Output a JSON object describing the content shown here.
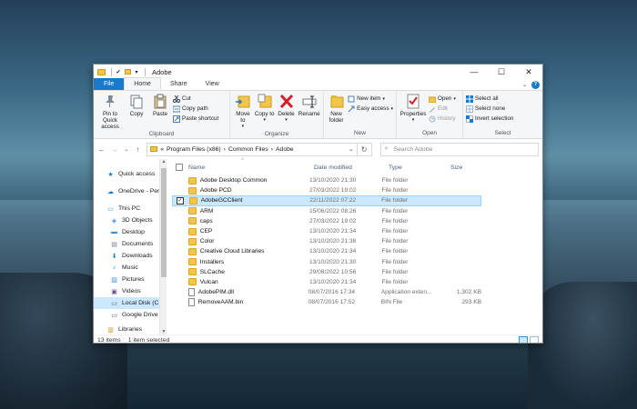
{
  "window": {
    "title": "Adobe",
    "controls": {
      "minimize": "—",
      "maximize": "☐",
      "close": "✕"
    }
  },
  "ribbon_tabs": [
    "File",
    "Home",
    "Share",
    "View"
  ],
  "ribbon": {
    "clipboard": {
      "pin": "Pin to Quick access",
      "copy": "Copy",
      "paste": "Paste",
      "cut": "Cut",
      "copy_path": "Copy path",
      "paste_shortcut": "Paste shortcut",
      "label": "Clipboard"
    },
    "organize": {
      "move_to": "Move to",
      "copy_to": "Copy to",
      "delete": "Delete",
      "rename": "Rename",
      "label": "Organize"
    },
    "new": {
      "new_folder": "New folder",
      "new_item": "New item",
      "easy_access": "Easy access",
      "label": "New"
    },
    "open": {
      "properties": "Properties",
      "open": "Open",
      "edit": "Edit",
      "history": "History",
      "label": "Open"
    },
    "select": {
      "select_all": "Select all",
      "select_none": "Select none",
      "invert_selection": "Invert selection",
      "label": "Select"
    }
  },
  "address": {
    "prefix": "«",
    "path": [
      "Program Files (x86)",
      "Common Files",
      "Adobe"
    ],
    "search_placeholder": "Search Adobe"
  },
  "nav_pane": [
    {
      "label": "Quick access",
      "icon": "star-icon"
    },
    {
      "label": "OneDrive - Persor",
      "icon": "cloud-icon"
    },
    {
      "label": "This PC",
      "icon": "computer-icon"
    },
    {
      "label": "3D Objects",
      "icon": "cube-icon"
    },
    {
      "label": "Desktop",
      "icon": "desktop-icon"
    },
    {
      "label": "Documents",
      "icon": "documents-icon"
    },
    {
      "label": "Downloads",
      "icon": "download-icon"
    },
    {
      "label": "Music",
      "icon": "music-icon"
    },
    {
      "label": "Pictures",
      "icon": "pictures-icon"
    },
    {
      "label": "Videos",
      "icon": "video-icon"
    },
    {
      "label": "Local Disk (C:)",
      "icon": "drive-icon"
    },
    {
      "label": "Google Drive (G:",
      "icon": "drive-icon"
    },
    {
      "label": "Libraries",
      "icon": "library-icon"
    }
  ],
  "columns": {
    "name": "Name",
    "date": "Date modified",
    "type": "Type",
    "size": "Size"
  },
  "files": [
    {
      "name": "Adobe Desktop Common",
      "date": "13/10/2020 21:30",
      "type": "File folder",
      "size": "",
      "kind": "folder"
    },
    {
      "name": "Adobe PCD",
      "date": "27/03/2022 19:02",
      "type": "File folder",
      "size": "",
      "kind": "folder"
    },
    {
      "name": "AdobeGCClient",
      "date": "22/11/2022 07:22",
      "type": "File folder",
      "size": "",
      "kind": "folder"
    },
    {
      "name": "ARM",
      "date": "15/06/2022 08:26",
      "type": "File folder",
      "size": "",
      "kind": "folder"
    },
    {
      "name": "caps",
      "date": "27/03/2022 19:02",
      "type": "File folder",
      "size": "",
      "kind": "folder"
    },
    {
      "name": "CEP",
      "date": "13/10/2020 21:34",
      "type": "File folder",
      "size": "",
      "kind": "folder"
    },
    {
      "name": "Color",
      "date": "13/10/2020 21:38",
      "type": "File folder",
      "size": "",
      "kind": "folder"
    },
    {
      "name": "Creative Cloud Libraries",
      "date": "13/10/2020 21:34",
      "type": "File folder",
      "size": "",
      "kind": "folder"
    },
    {
      "name": "Installers",
      "date": "13/10/2020 21:30",
      "type": "File folder",
      "size": "",
      "kind": "folder"
    },
    {
      "name": "SLCache",
      "date": "29/08/2022 10:56",
      "type": "File folder",
      "size": "",
      "kind": "folder"
    },
    {
      "name": "Vulcan",
      "date": "13/10/2020 21:34",
      "type": "File folder",
      "size": "",
      "kind": "folder"
    },
    {
      "name": "AdobePIM.dll",
      "date": "08/07/2016 17:34",
      "type": "Application exten...",
      "size": "1,302 KB",
      "kind": "file"
    },
    {
      "name": "RemoveAAM.bin",
      "date": "08/07/2016 17:52",
      "type": "BIN File",
      "size": "293 KB",
      "kind": "file"
    }
  ],
  "selected_row": 2,
  "status": {
    "items": "13 items",
    "selected": "1 item selected"
  },
  "colors": {
    "accent": "#1979ca",
    "selection": "#cce8ff",
    "folder": "#f3c64a"
  }
}
